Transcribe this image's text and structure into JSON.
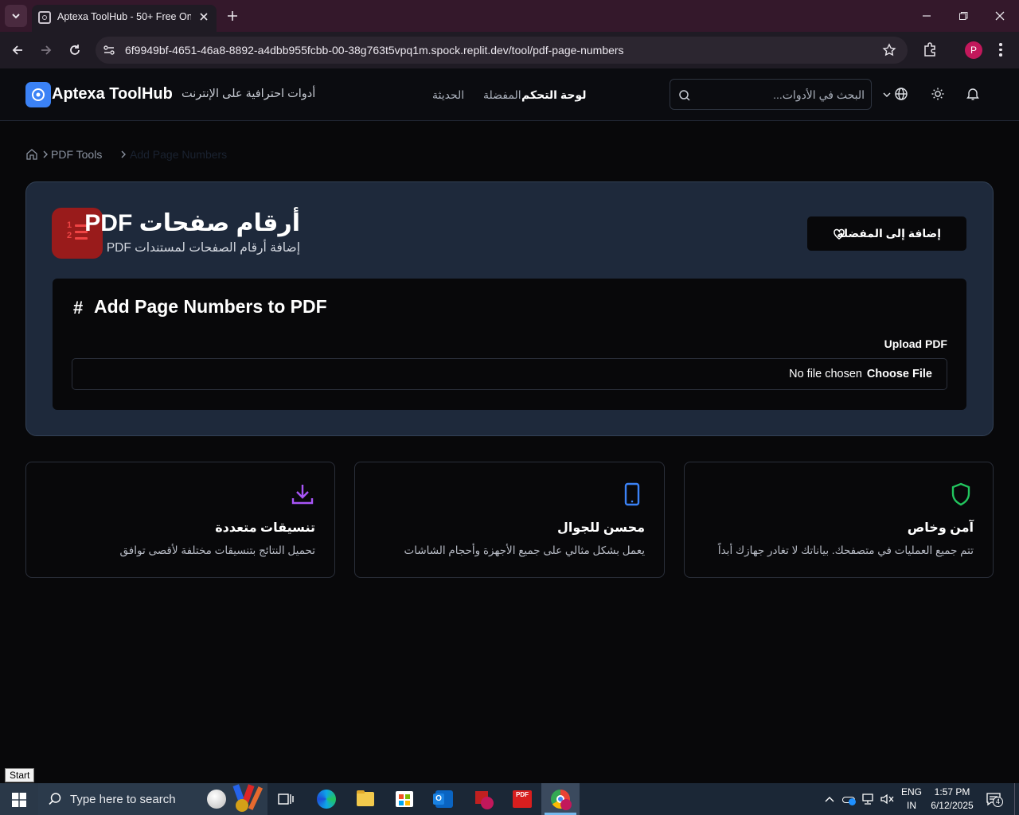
{
  "browser": {
    "tab_title": "Aptexa ToolHub - 50+ Free Onl",
    "url": "6f9949bf-4651-46a8-8892-a4dbb955fcbb-00-38g763t5vpq1m.spock.replit.dev/tool/pdf-page-numbers",
    "profile_initial": "P"
  },
  "header": {
    "brand": "Aptexa ToolHub",
    "tagline": "أدوات احترافية على الإنترنت",
    "nav": {
      "recent": "الحديثة",
      "favorites": "المفضلة",
      "dashboard": "لوحة التحكم"
    },
    "search_placeholder": "البحث في الأدوات..."
  },
  "breadcrumb": {
    "section": "PDF Tools",
    "current": "Add Page Numbers"
  },
  "tool": {
    "title": "أرقام صفحات PDF",
    "subtitle": "إضافة أرقام الصفحات لمستندات PDF",
    "favorite_button": "إضافة إلى المفضلة",
    "icon_digits": [
      "1",
      "2"
    ]
  },
  "panel": {
    "hash": "#",
    "title": "Add Page Numbers to PDF",
    "upload_label": "Upload PDF",
    "choose_button": "Choose File",
    "file_status": "No file chosen"
  },
  "features": [
    {
      "title": "تنسيقات متعددة",
      "desc": "تحميل النتائج بتنسيقات مختلفة لأقصى توافق",
      "icon": "download-icon",
      "color": "#a855f7"
    },
    {
      "title": "محسن للجوال",
      "desc": "يعمل بشكل مثالي على جميع الأجهزة وأحجام الشاشات",
      "icon": "mobile-icon",
      "color": "#3b82f6"
    },
    {
      "title": "آمن وخاص",
      "desc": "تتم جميع العمليات في متصفحك. بياناتك لا تغادر جهازك أبداً",
      "icon": "shield-icon",
      "color": "#22c55e"
    }
  ],
  "taskbar": {
    "start_tooltip": "Start",
    "search_placeholder": "Type here to search",
    "lang_1": "ENG",
    "lang_2": "IN",
    "time": "1:57 PM",
    "date": "6/12/2025",
    "notification_count": "4"
  },
  "colors": {
    "accent_icon_bg": "#991b1b",
    "card_bg": "#1e293b",
    "logo_bg": "#3b82f6"
  }
}
